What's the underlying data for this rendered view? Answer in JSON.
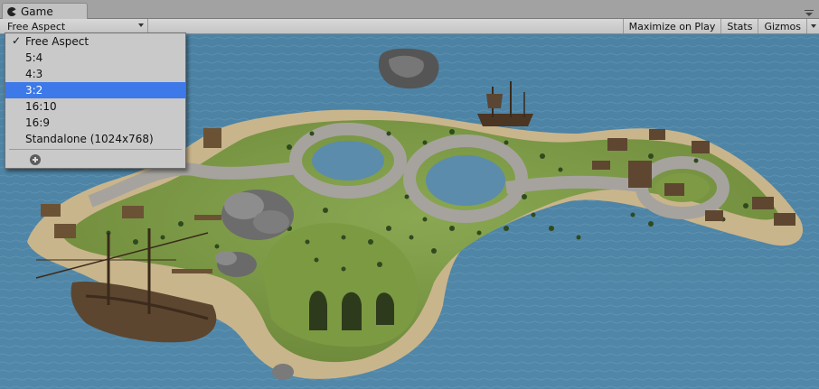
{
  "tab": {
    "label": "Game",
    "icon": "pacman-icon"
  },
  "toolbar": {
    "aspect_value": "Free Aspect",
    "maximize_label": "Maximize on Play",
    "stats_label": "Stats",
    "gizmos_label": "Gizmos"
  },
  "aspect_menu": {
    "items": [
      {
        "label": "Free Aspect",
        "checked": true
      },
      {
        "label": "5:4"
      },
      {
        "label": "4:3"
      },
      {
        "label": "3:2",
        "highlighted": true
      },
      {
        "label": "16:10"
      },
      {
        "label": "16:9"
      },
      {
        "label": "Standalone (1024x768)"
      }
    ],
    "add_icon": "plus-circle-icon"
  },
  "scene": {
    "content": "pirate-island-game-view",
    "colors": {
      "sea": "#4d83a4",
      "grass": "#7e9a45",
      "sand": "#c9b58c",
      "road": "#a5a29d",
      "rock": "#6d6d6d",
      "wood": "#6b5235",
      "highlight": "#3d79e8"
    }
  }
}
